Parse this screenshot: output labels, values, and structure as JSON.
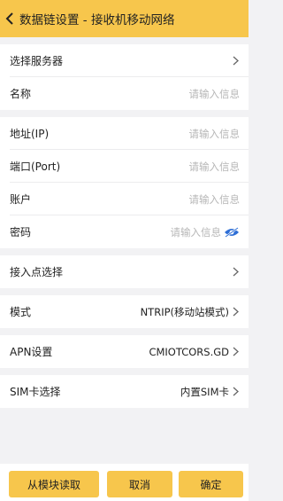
{
  "header": {
    "title": "数据链设置 - 接收机移动网络"
  },
  "server_group": {
    "select_server": "选择服务器",
    "name_label": "名称",
    "name_placeholder": "请输入信息"
  },
  "conn_group": {
    "address_label": "地址(IP)",
    "address_placeholder": "请输入信息",
    "port_label": "端口(Port)",
    "port_placeholder": "请输入信息",
    "account_label": "账户",
    "account_placeholder": "请输入信息",
    "password_label": "密码",
    "password_placeholder": "请输入信息"
  },
  "mount_group": {
    "label": "接入点选择"
  },
  "mode_group": {
    "label": "模式",
    "value": "NTRIP(移动站模式)"
  },
  "apn_group": {
    "label": "APN设置",
    "value": "CMIOTCORS.GD"
  },
  "sim_group": {
    "label": "SIM卡选择",
    "value": "内置SIM卡"
  },
  "footer": {
    "read_label": "从模块读取",
    "cancel_label": "取消",
    "confirm_label": "确定"
  },
  "colors": {
    "accent": "#f7c64c",
    "eye_icon": "#2f6fd6",
    "background": "#f2f2f4"
  },
  "icons": [
    "back-chevron-icon",
    "chevron-right-icon",
    "eye-hidden-icon"
  ]
}
